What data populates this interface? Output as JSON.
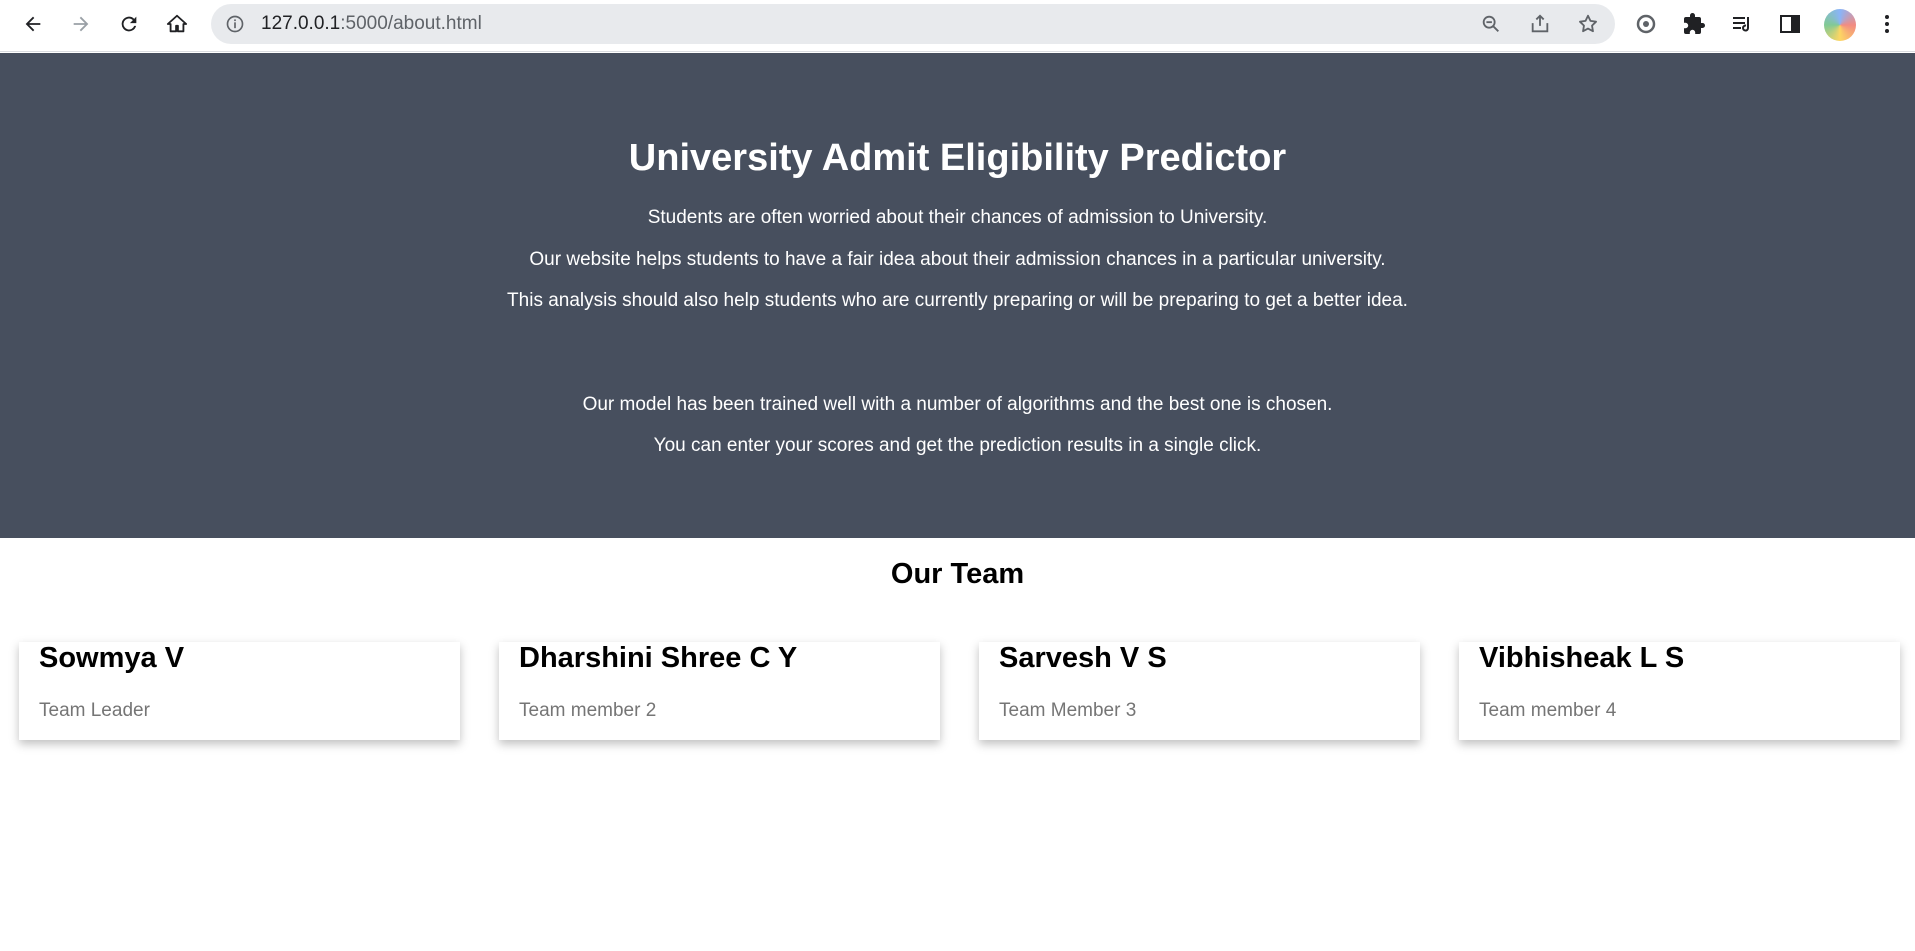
{
  "browser": {
    "url_host": "127.0.0.1",
    "url_path": ":5000/about.html"
  },
  "hero": {
    "title": "University Admit Eligibility Predictor",
    "lines": [
      "Students are often worried about their chances of admission to University.",
      "Our website helps students to have a fair idea about their admission chances in a particular university.",
      "This analysis should also help students who are currently preparing or will be preparing to get a better idea.",
      "Our model has been trained well with a number of algorithms and the best one is chosen.",
      "You can enter your scores and get the prediction results in a single click."
    ]
  },
  "team": {
    "heading": "Our Team",
    "members": [
      {
        "name": "Sowmya V",
        "role": "Team Leader"
      },
      {
        "name": "Dharshini Shree C Y",
        "role": "Team member 2"
      },
      {
        "name": "Sarvesh V S",
        "role": "Team Member 3"
      },
      {
        "name": "Vibhisheak L S",
        "role": "Team member 4"
      }
    ]
  },
  "colors": {
    "hero_bg": "#474f5e",
    "role_text": "#757575"
  }
}
